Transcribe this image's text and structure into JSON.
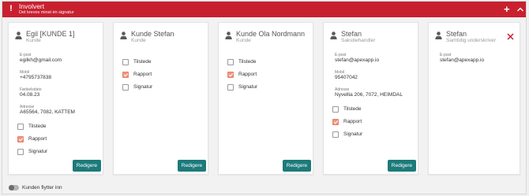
{
  "header": {
    "title": "Involvert",
    "subtitle": "Det kreves minst én signatur",
    "warn_glyph": "!",
    "add_glyph": "+",
    "color": "#c8202f"
  },
  "cards": [
    {
      "name": "Egil [KUNDE 1]",
      "role": "Kunde",
      "fields": [
        {
          "label": "E-post",
          "value": "egilkh@gmail.com"
        },
        {
          "label": "Mobil",
          "value": "+4795737838"
        },
        {
          "label": "Fødselsdato",
          "value": "04.08.23"
        },
        {
          "label": "Adresse",
          "value": "A65564, 7082, KATTEM"
        }
      ],
      "checks": [
        {
          "label": "Tilstede",
          "checked": false
        },
        {
          "label": "Rapport",
          "checked": true
        },
        {
          "label": "Signatur",
          "checked": false
        }
      ],
      "button": "Redigere"
    },
    {
      "name": "Kunde Stefan",
      "role": "Kunde",
      "fields": [],
      "checks": [
        {
          "label": "Tilstede",
          "checked": false
        },
        {
          "label": "Rapport",
          "checked": true
        },
        {
          "label": "Signatur",
          "checked": false
        }
      ],
      "button": "Redigere"
    },
    {
      "name": "Kunde Ola Nordmann",
      "role": "Kunde",
      "fields": [],
      "checks": [
        {
          "label": "Tilstede",
          "checked": false
        },
        {
          "label": "Rapport",
          "checked": true
        },
        {
          "label": "Signatur",
          "checked": false
        }
      ],
      "button": "Redigere"
    },
    {
      "name": "Stefan",
      "role": "Saksbehandler",
      "fields": [
        {
          "label": "E-post",
          "value": "stefan@apexapp.io"
        },
        {
          "label": "Mobil",
          "value": "95407042"
        },
        {
          "label": "Adresse",
          "value": "Nyvellia 206, 7072, HEIMDAL"
        }
      ],
      "checks": [
        {
          "label": "Tilstede",
          "checked": false
        },
        {
          "label": "Rapport",
          "checked": true
        },
        {
          "label": "Signatur",
          "checked": false
        }
      ],
      "button": "Redigere"
    },
    {
      "name": "Stefan",
      "role": "Samtidig underskriver",
      "fields": [
        {
          "label": "E-post",
          "value": "stefan@apexapp.io"
        }
      ],
      "checks": [],
      "button": ""
    }
  ],
  "footer": {
    "toggle_label": "Kunden flytter inn",
    "toggle_on": false
  },
  "colors": {
    "accent_button": "#1d7a7a",
    "checkbox_checked": "#f0947e",
    "close_icon": "#c8202f"
  }
}
